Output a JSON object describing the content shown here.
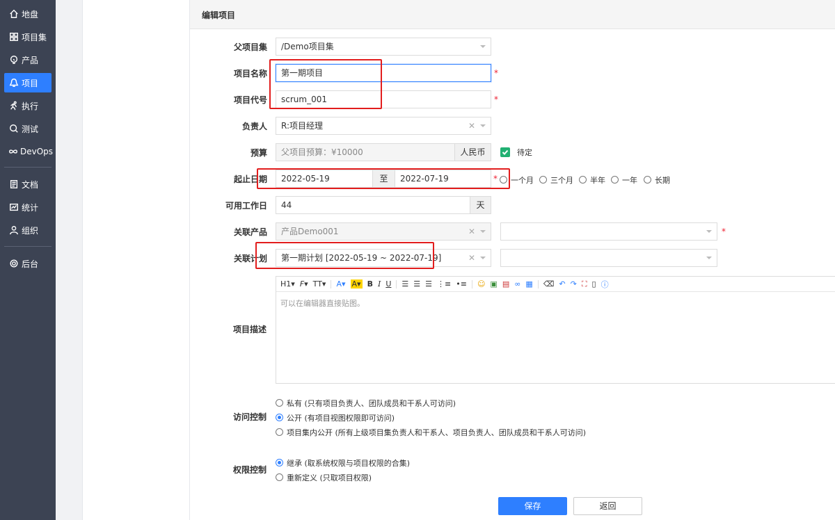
{
  "sidebar": {
    "items": [
      {
        "label": "地盘",
        "icon": "home-icon"
      },
      {
        "label": "项目集",
        "icon": "grid-icon"
      },
      {
        "label": "产品",
        "icon": "product-icon"
      },
      {
        "label": "项目",
        "icon": "project-icon",
        "active": true
      },
      {
        "label": "执行",
        "icon": "run-icon"
      },
      {
        "label": "测试",
        "icon": "search-icon"
      },
      {
        "label": "DevOps",
        "icon": "infinity-icon"
      },
      {
        "label": "文档",
        "icon": "doc-icon"
      },
      {
        "label": "统计",
        "icon": "chart-icon"
      },
      {
        "label": "组织",
        "icon": "user-icon"
      },
      {
        "label": "后台",
        "icon": "gear-icon"
      }
    ]
  },
  "form": {
    "title": "编辑项目",
    "parent": {
      "label": "父项目集",
      "value": "/Demo项目集"
    },
    "name": {
      "label": "项目名称",
      "value": "第一期项目"
    },
    "code": {
      "label": "项目代号",
      "value": "scrum_001"
    },
    "owner": {
      "label": "负责人",
      "value": "R:项目经理"
    },
    "budget": {
      "label": "预算",
      "placeholder": "父项目预算：¥10000",
      "unit": "人民币",
      "tbd": "待定"
    },
    "dates": {
      "label": "起止日期",
      "begin": "2022-05-19",
      "sep": "至",
      "end": "2022-07-19",
      "options": [
        "一个月",
        "三个月",
        "半年",
        "一年",
        "长期"
      ]
    },
    "workdays": {
      "label": "可用工作日",
      "value": "44",
      "unit": "天"
    },
    "product": {
      "label": "关联产品",
      "value": "产品Demo001"
    },
    "plan": {
      "label": "关联计划",
      "value": "第一期计划 [2022-05-19 ~ 2022-07-19]"
    },
    "desc": {
      "label": "项目描述",
      "placeholder": "可以在编辑器直接贴图。",
      "toolbar": [
        "H1",
        "F",
        "TT",
        "A",
        "A",
        "B",
        "I",
        "U"
      ]
    },
    "access": {
      "label": "访问控制",
      "options": [
        {
          "text": "私有 (只有项目负责人、团队成员和干系人可访问)",
          "checked": false
        },
        {
          "text": "公开 (有项目视图权限即可访问)",
          "checked": true
        },
        {
          "text": "项目集内公开 (所有上级项目集负责人和干系人、项目负责人、团队成员和干系人可访问)",
          "checked": false
        }
      ]
    },
    "acl": {
      "label": "权限控制",
      "options": [
        {
          "text": "继承 (取系统权限与项目权限的合集)",
          "checked": true
        },
        {
          "text": "重新定义 (只取项目权限)",
          "checked": false
        }
      ]
    },
    "save": "保存",
    "back": "返回"
  }
}
